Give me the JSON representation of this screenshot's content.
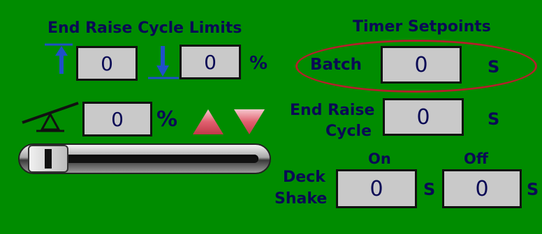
{
  "end_raise": {
    "title": "End Raise Cycle Limits",
    "upper_value": "0",
    "lower_value": "0",
    "unit": "%",
    "icons": {
      "upper": "arrow-up-to-line-icon",
      "lower": "arrow-down-to-line-icon"
    }
  },
  "tilt": {
    "value": "0",
    "unit": "%",
    "icon": "seesaw-icon",
    "up_icon": "triangle-up-icon",
    "down_icon": "triangle-down-icon",
    "slider_level": 0.0
  },
  "timer": {
    "title": "Timer Setpoints",
    "batch": {
      "label": "Batch",
      "value": "0",
      "unit": "S"
    },
    "end_raise_cycle": {
      "label_line1": "End Raise",
      "label_line2": "Cycle",
      "value": "0",
      "unit": "S"
    },
    "deck_shake": {
      "label_line1": "Deck",
      "label_line2": "Shake",
      "on_label": "On",
      "off_label": "Off",
      "on_value": "0",
      "off_value": "0",
      "unit": "S"
    }
  },
  "colors": {
    "background": "#008c00",
    "text": "#0a0a55",
    "field_bg": "#c9c9c9",
    "arrow_blue": "#1f4fc9",
    "triangle_red": "#d94a5e",
    "highlight_ellipse": "#b3202a"
  }
}
